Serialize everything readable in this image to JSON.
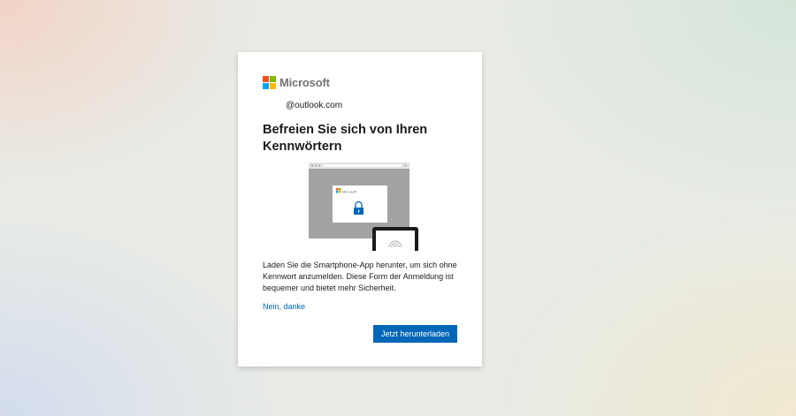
{
  "brand": {
    "name": "Microsoft",
    "colors": [
      "#f25022",
      "#7fba00",
      "#00a4ef",
      "#ffb900"
    ]
  },
  "account": {
    "email_suffix": "@outlook.com"
  },
  "dialog": {
    "title": "Befreien Sie sich von Ihren Kennwörtern",
    "description": "Laden Sie die Smartphone-App herunter, um sich ohne Kennwort anzumelden. Diese Form der Anmeldung ist bequemer und bietet mehr Sicherheit.",
    "decline_link": "Nein, danke",
    "primary_button": "Jetzt herunterladen"
  },
  "illustration": {
    "mini_brand": "Microsoft",
    "icons": [
      "browser-window",
      "lock-icon",
      "phone",
      "fingerprint-icon"
    ]
  },
  "colors": {
    "accent": "#0067b8",
    "text": "#1b1b1b",
    "logo_text": "#737373"
  }
}
